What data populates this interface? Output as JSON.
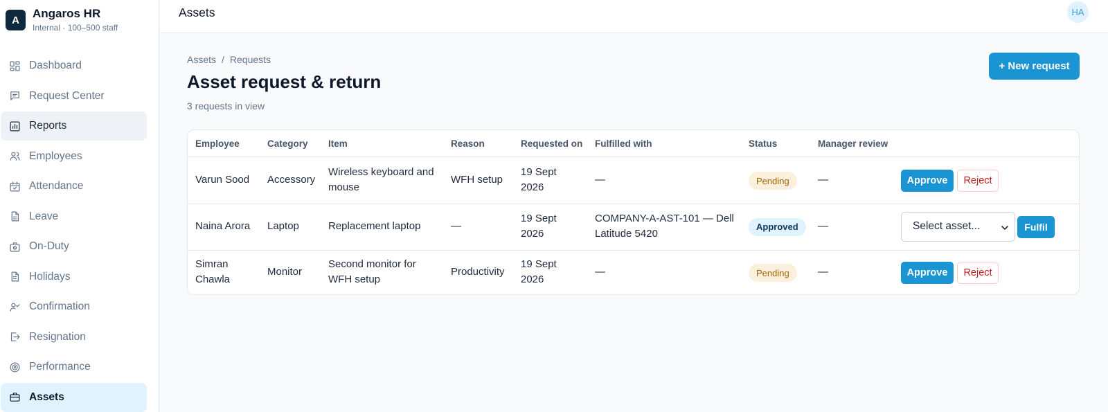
{
  "brand": {
    "logo_letter": "A",
    "name": "Angaros HR",
    "subtitle": "Internal · 100–500 staff"
  },
  "sidebar": {
    "items": [
      {
        "label": "Dashboard",
        "icon": "dashboard-icon",
        "state": "default"
      },
      {
        "label": "Request Center",
        "icon": "message-icon",
        "state": "default"
      },
      {
        "label": "Reports",
        "icon": "bar-chart-icon",
        "state": "hover"
      },
      {
        "label": "Employees",
        "icon": "users-icon",
        "state": "default"
      },
      {
        "label": "Attendance",
        "icon": "calendar-check-icon",
        "state": "default"
      },
      {
        "label": "Leave",
        "icon": "document-icon",
        "state": "default"
      },
      {
        "label": "On-Duty",
        "icon": "briefcase-clock-icon",
        "state": "default"
      },
      {
        "label": "Holidays",
        "icon": "document-list-icon",
        "state": "default"
      },
      {
        "label": "Confirmation",
        "icon": "user-check-icon",
        "state": "default"
      },
      {
        "label": "Resignation",
        "icon": "logout-icon",
        "state": "default"
      },
      {
        "label": "Performance",
        "icon": "target-icon",
        "state": "default"
      },
      {
        "label": "Assets",
        "icon": "briefcase-icon",
        "state": "active"
      }
    ]
  },
  "topbar": {
    "title": "Assets",
    "avatar_initials": "HA"
  },
  "main": {
    "breadcrumb": {
      "root": "Assets",
      "separator": "/",
      "current": "Requests"
    },
    "title": "Asset request & return",
    "count": "3 requests in view",
    "new_button": "+ New request"
  },
  "table": {
    "headers": [
      "Employee",
      "Category",
      "Item",
      "Reason",
      "Requested on",
      "Fulfilled with",
      "Status",
      "Manager review"
    ],
    "rows": [
      {
        "employee": [
          "Varun Sood"
        ],
        "category": "Accessory",
        "item": [
          "Wireless keyboard and",
          "mouse"
        ],
        "reason": "WFH setup",
        "requested": [
          "19 Sept",
          "2026"
        ],
        "fulfilled": [
          "—"
        ],
        "status": "Pending",
        "review": "—",
        "actions": {
          "type": "review",
          "approve": "Approve",
          "reject": "Reject"
        }
      },
      {
        "employee": [
          "Naina Arora"
        ],
        "category": "Laptop",
        "item": [
          "Replacement laptop"
        ],
        "reason": "—",
        "requested": [
          "19 Sept",
          "2026"
        ],
        "fulfilled": [
          "COMPANY-A-AST-101 — Dell",
          "Latitude 5420"
        ],
        "status": "Approved",
        "review": "—",
        "actions": {
          "type": "fulfil",
          "select": "Select asset...",
          "fulfil": "Fulfil"
        }
      },
      {
        "employee": [
          "Simran",
          "Chawla"
        ],
        "category": "Monitor",
        "item": [
          "Second monitor for",
          "WFH setup"
        ],
        "reason": "Productivity",
        "requested": [
          "19 Sept",
          "2026"
        ],
        "fulfilled": [
          "—"
        ],
        "status": "Pending",
        "review": "—",
        "actions": {
          "type": "review",
          "approve": "Approve",
          "reject": "Reject"
        }
      }
    ]
  },
  "colors": {
    "primary": "#1a94d2",
    "brand_dark": "#0f2a3f",
    "active_nav": "#e0f2fe",
    "pending_bg": "#fbf0db",
    "reject_text": "#b91c1c"
  }
}
